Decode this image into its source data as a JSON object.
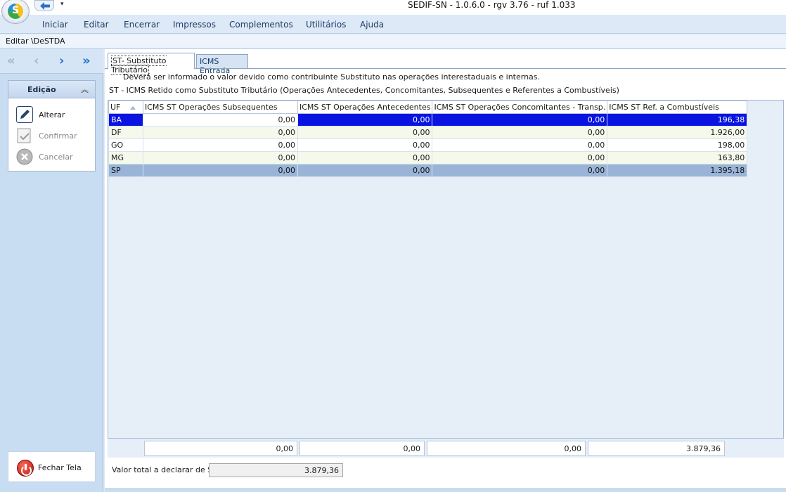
{
  "window": {
    "title": "SEDIF-SN - 1.0.6.0 - rgv 3.76 - ruf 1.033"
  },
  "menu": [
    "Iniciar",
    "Editar",
    "Encerrar",
    "Impressos",
    "Complementos",
    "Utilitários",
    "Ajuda"
  ],
  "breadcrumb": "Editar \\DeSTDA",
  "sidebar": {
    "panel_title": "Edição",
    "actions": {
      "alterar": "Alterar",
      "confirmar": "Confirmar",
      "cancelar": "Cancelar"
    },
    "close_label": "Fechar Tela"
  },
  "tabs": {
    "active": "ST- Substituto Tributário",
    "inactive": "ICMS Entrada"
  },
  "description": {
    "line1": "Deverá ser informado o valor devido como contribuinte Substituto nas operações interestaduais e internas.",
    "line2": "ST - ICMS Retido como Substituto Tributário (Operações Antecedentes, Concomitantes, Subsequentes e Referentes a Combustíveis)"
  },
  "grid": {
    "columns": [
      "UF",
      "ICMS ST Operações Subsequentes",
      "ICMS ST Operações Antecedentes",
      "ICMS ST Operações Concomitantes - Transp.",
      "ICMS ST Ref. a Combustíveis"
    ],
    "rows": [
      {
        "uf": "BA",
        "subsequentes": "0,00",
        "antecedentes": "0,00",
        "concomitantes": "0,00",
        "combustiveis": "196,38"
      },
      {
        "uf": "DF",
        "subsequentes": "0,00",
        "antecedentes": "0,00",
        "concomitantes": "0,00",
        "combustiveis": "1.926,00"
      },
      {
        "uf": "GO",
        "subsequentes": "0,00",
        "antecedentes": "0,00",
        "concomitantes": "0,00",
        "combustiveis": "198,00"
      },
      {
        "uf": "MG",
        "subsequentes": "0,00",
        "antecedentes": "0,00",
        "concomitantes": "0,00",
        "combustiveis": "163,80"
      },
      {
        "uf": "SP",
        "subsequentes": "0,00",
        "antecedentes": "0,00",
        "concomitantes": "0,00",
        "combustiveis": "1.395,18"
      }
    ],
    "totals": {
      "subsequentes": "0,00",
      "antecedentes": "0,00",
      "concomitantes": "0,00",
      "combustiveis": "3.879,36"
    }
  },
  "total": {
    "label": "Valor total a declarar de ST",
    "value": "3.879,36"
  },
  "colors": {
    "selection_blue": "#0a14e0",
    "selected_row": "#99b4d6",
    "menu_bg": "#dde9f7"
  }
}
